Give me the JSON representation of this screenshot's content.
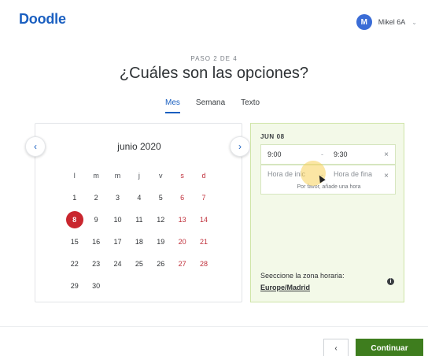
{
  "header": {
    "logo": "Doodle",
    "avatar_initial": "M",
    "username": "Mikel 6A"
  },
  "step": "PASO 2 DE 4",
  "title": "¿Cuáles son las opciones?",
  "tabs": [
    {
      "label": "Mes",
      "active": true
    },
    {
      "label": "Semana",
      "active": false
    },
    {
      "label": "Texto",
      "active": false
    }
  ],
  "calendar": {
    "month": "junio 2020",
    "weekdays": [
      "l",
      "m",
      "m",
      "j",
      "v",
      "s",
      "d"
    ],
    "weeks": [
      [
        "1",
        "2",
        "3",
        "4",
        "5",
        "6",
        "7"
      ],
      [
        "8",
        "9",
        "10",
        "11",
        "12",
        "13",
        "14"
      ],
      [
        "15",
        "16",
        "17",
        "18",
        "19",
        "20",
        "21"
      ],
      [
        "22",
        "23",
        "24",
        "25",
        "26",
        "27",
        "28"
      ],
      [
        "29",
        "30",
        "",
        "",
        "",
        "",
        ""
      ]
    ],
    "selected_day": "8"
  },
  "panel": {
    "date": "JUN 08",
    "slot1": {
      "start": "9:00",
      "separator": "-",
      "end": "9:30",
      "remove": "×"
    },
    "slot2": {
      "start_placeholder": "Hora de inic",
      "end_placeholder": "Hora de fina",
      "separator": "-",
      "remove": "×",
      "hint": "Por favor, añade una hora"
    },
    "timezone_label": "Seeccione la zona horaria:",
    "timezone_value": "Europe/Madrid",
    "info_icon": "i"
  },
  "footer": {
    "back": "‹",
    "continue": "Continuar"
  },
  "nav": {
    "prev": "‹",
    "next": "›"
  },
  "colors": {
    "brand": "#1a5fc0",
    "weekend": "#c0303b",
    "selected": "#c9262e",
    "continue": "#3e7d1e",
    "panel_bg": "#f3f9e8"
  }
}
